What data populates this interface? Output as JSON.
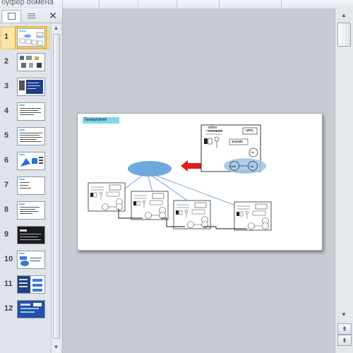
{
  "ribbon": {
    "group_label": "буфер обмена"
  },
  "pane": {
    "tabs": [
      {
        "name": "slides-tab",
        "icon": "slides-tab-icon"
      },
      {
        "name": "outline-tab",
        "icon": "outline-tab-icon"
      }
    ],
    "close_label": "✕",
    "selected_slide": "1",
    "slides": [
      "1",
      "2",
      "3",
      "4",
      "5",
      "6",
      "7",
      "8",
      "9",
      "10",
      "11",
      "12"
    ]
  },
  "slide": {
    "title": "Технология",
    "tablo_label": "табло сознания",
    "goal_label": "цель",
    "knowledge_label": "знание",
    "op_label": "Ор",
    "pr_label": "Пр",
    "im_label": "ИсМ"
  },
  "colors": {
    "accent_selected": "#f0b43a",
    "ellipse_blue": "#6fa8dc",
    "arrow_red": "#e41b1b",
    "title_cyan": "#7fd4ef"
  }
}
